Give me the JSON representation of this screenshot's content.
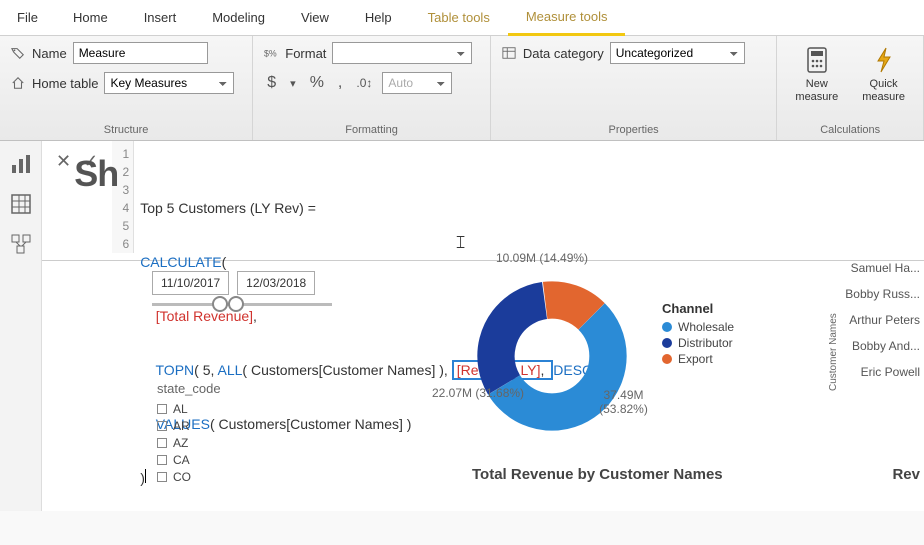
{
  "tabs": {
    "file": "File",
    "home": "Home",
    "insert": "Insert",
    "modeling": "Modeling",
    "view": "View",
    "help": "Help",
    "table_tools": "Table tools",
    "measure_tools": "Measure tools"
  },
  "ribbon": {
    "structure": {
      "name_label": "Name",
      "name_value": "Measure",
      "home_table_label": "Home table",
      "home_table_value": "Key Measures",
      "group": "Structure"
    },
    "formatting": {
      "format_label": "Format",
      "format_value": "",
      "auto_value": "Auto",
      "currency": "$",
      "percent": "%",
      "comma": ",",
      "decimals": ".0",
      "group": "Formatting"
    },
    "properties": {
      "data_category_label": "Data category",
      "data_category_value": "Uncategorized",
      "group": "Properties"
    },
    "calculations": {
      "new_measure": "New\nmeasure",
      "quick_measure": "Quick\nmeasure",
      "group": "Calculations"
    }
  },
  "formula": {
    "line1_a": "Top 5 Customers (LY Rev) =",
    "line2_a": "CALCULATE",
    "line2_b": "(",
    "line3_a": "[Total Revenue]",
    "line3_b": ",",
    "line4_a": "TOPN",
    "line4_b": "( 5, ",
    "line4_c": "ALL",
    "line4_d": "( Customers[Customer Names] )",
    "line4_hl": "[Revenue LY]",
    "line4_e": ",",
    "line4_f": "DESC",
    "line4_g": " ),",
    "line5_a": "VALUES",
    "line5_b": "( Customers[Customer Names] )",
    "line6_a": ")",
    "gutter": [
      "1",
      "2",
      "3",
      "4",
      "5",
      "6"
    ]
  },
  "slicer": {
    "date1": "11/10/2017",
    "date2": "12/03/2018",
    "state_title": "state_code",
    "states": [
      "AL",
      "AR",
      "AZ",
      "CA",
      "CO"
    ]
  },
  "chart_data": {
    "type": "pie",
    "title": "Channel",
    "values": [
      37.49,
      22.07,
      10.09
    ],
    "percents": [
      53.82,
      31.68,
      14.49
    ],
    "labels": [
      "Wholesale",
      "Distributor",
      "Export"
    ],
    "colors": [
      "#2b8bd6",
      "#1b3c9b",
      "#e2662f"
    ],
    "value_unit": "M",
    "datalabels": {
      "top": "10.09M\n(14.49%)",
      "left": "22.07M\n(31.68%)",
      "right": "37.49M\n(53.82%)"
    }
  },
  "legend": {
    "title": "Channel",
    "items": [
      {
        "label": "Wholesale",
        "color": "#2b8bd6"
      },
      {
        "label": "Distributor",
        "color": "#1b3c9b"
      },
      {
        "label": "Export",
        "color": "#e2662f"
      }
    ]
  },
  "customers": {
    "axis": "Customer Names",
    "names": [
      "Samuel Ha...",
      "Bobby Russ...",
      "Arthur Peters",
      "Bobby And...",
      "Eric Powell"
    ]
  },
  "titles": {
    "main_chart": "Total Revenue by Customer Names",
    "right_chart": "Rev"
  },
  "watermark": "Sh"
}
